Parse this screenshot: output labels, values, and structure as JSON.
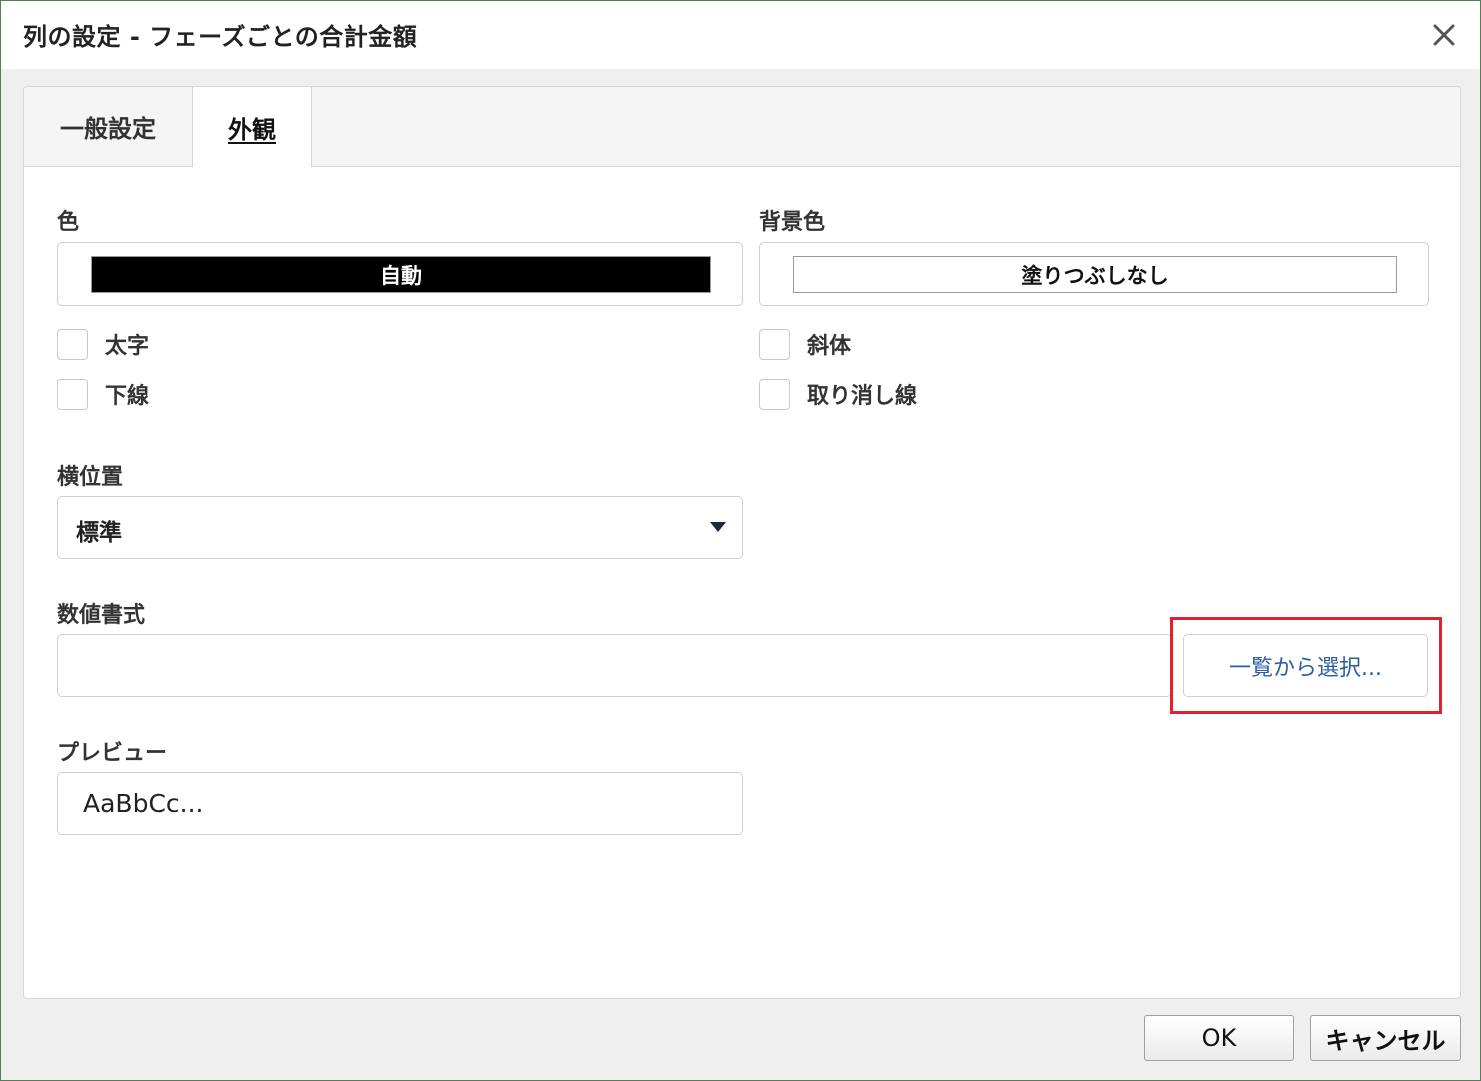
{
  "dialog": {
    "title": "列の設定 - フェーズごとの合計金額",
    "close_icon": "close-icon"
  },
  "tabs": [
    {
      "label": "一般設定",
      "active": false
    },
    {
      "label": "外観",
      "active": true
    }
  ],
  "appearance": {
    "color": {
      "label": "色",
      "value": "自動",
      "swatch": "#000000"
    },
    "background": {
      "label": "背景色",
      "value": "塗りつぶしなし",
      "swatch": "#ffffff"
    },
    "checkboxes": {
      "bold": {
        "label": "太字",
        "checked": false
      },
      "italic": {
        "label": "斜体",
        "checked": false
      },
      "underline": {
        "label": "下線",
        "checked": false
      },
      "strikethrough": {
        "label": "取り消し線",
        "checked": false
      }
    },
    "horizontal_align": {
      "label": "横位置",
      "value": "標準"
    },
    "number_format": {
      "label": "数値書式",
      "value": "",
      "pick_button": "一覧から選択..."
    },
    "preview": {
      "label": "プレビュー",
      "value": "AaBbCc..."
    }
  },
  "footer": {
    "ok_label": "OK",
    "cancel_label": "キャンセル"
  },
  "colors": {
    "accent_link": "#2d5ea3",
    "highlight": "#e0212f",
    "frame": "#4f7f52"
  }
}
